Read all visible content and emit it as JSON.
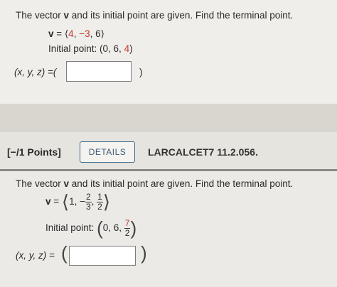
{
  "question1": {
    "prompt_start": "The vector ",
    "prompt_bold": "v",
    "prompt_end": " and its initial point are given. Find the terminal point.",
    "v_label": "v",
    "v_eq": " = ⟨",
    "v_components": [
      "4",
      "−3",
      "6"
    ],
    "v_close": "⟩",
    "initial_label": "Initial point: (0, 6, ",
    "initial_red": "4",
    "initial_close": ")",
    "answer_label": "(x, y, z) =(",
    "answer_value": "",
    "answer_close": ")"
  },
  "header": {
    "points": "[−/1 Points]",
    "details_button": "DETAILS",
    "problem_code": "LARCALCET7 11.2.056."
  },
  "question2": {
    "prompt_start": "The vector ",
    "prompt_bold": "v",
    "prompt_end": " and its initial point are given. Find the terminal point.",
    "v_label": "v",
    "v_eq": " = ",
    "v_first": "1, −",
    "frac1_num": "2",
    "frac1_den": "3",
    "frac2_num": "1",
    "frac2_den": "2",
    "initial_label": "Initial point:",
    "initial_vals": "0, 6,",
    "frac3_num": "7",
    "frac3_den": "2",
    "answer_label": "(x, y, z) = ",
    "answer_value": ""
  }
}
